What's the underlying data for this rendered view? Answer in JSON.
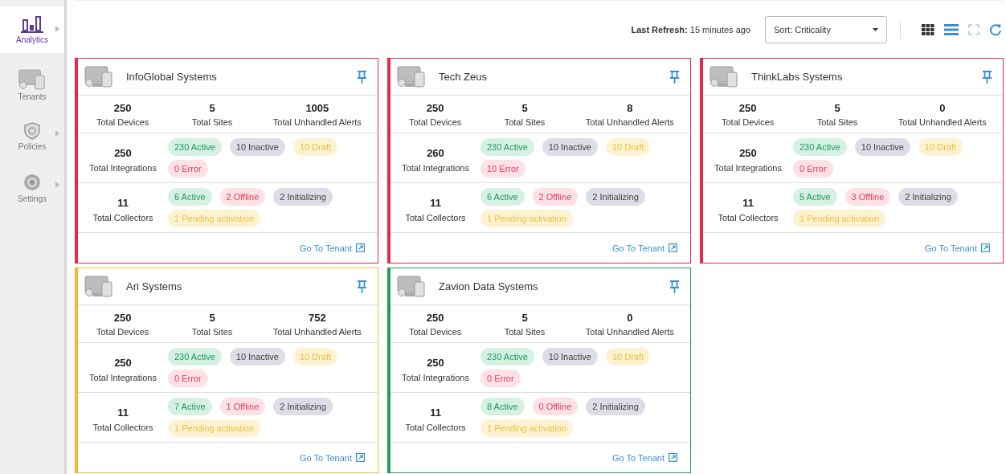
{
  "sidebar": {
    "items": [
      {
        "label": "Analytics",
        "selected": true,
        "expandable": true
      },
      {
        "label": "Tenants",
        "selected": false,
        "expandable": false
      },
      {
        "label": "Policies",
        "selected": false,
        "expandable": true
      },
      {
        "label": "Settings",
        "selected": false,
        "expandable": true
      }
    ]
  },
  "toolbar": {
    "refresh_label": "Last Refresh:",
    "refresh_value": "15 minutes ago",
    "sort": {
      "value": "Sort: Criticality"
    }
  },
  "cards": [
    {
      "name": "InfoGlobal Systems",
      "color": "#e8284a",
      "stats": [
        {
          "value": "250",
          "label": "Total Devices"
        },
        {
          "value": "5",
          "label": "Total Sites"
        },
        {
          "value": "1005",
          "label": "Total Unhandled Alerts"
        }
      ],
      "integrations": {
        "value": "250",
        "label": "Total Integrations",
        "badges": [
          {
            "kind": "good",
            "text": "230 Active"
          },
          {
            "kind": "neutral",
            "text": "10 Inactive"
          },
          {
            "kind": "warn",
            "text": "10 Draft"
          },
          {
            "kind": "bad",
            "text": "0 Error"
          }
        ]
      },
      "collectors": {
        "value": "11",
        "label": "Total Collectors",
        "badges": [
          {
            "kind": "good",
            "text": "6 Active"
          },
          {
            "kind": "bad",
            "text": "2 Offline"
          },
          {
            "kind": "neutral",
            "text": "2 Initializing"
          },
          {
            "kind": "warn",
            "text": "1 Pending activation"
          }
        ]
      },
      "link": "Go To Tenant"
    },
    {
      "name": "Tech Zeus",
      "color": "#e8284a",
      "stats": [
        {
          "value": "250",
          "label": "Total Devices"
        },
        {
          "value": "5",
          "label": "Total Sites"
        },
        {
          "value": "8",
          "label": "Total Unhandled Alerts"
        }
      ],
      "integrations": {
        "value": "260",
        "label": "Total Integrations",
        "badges": [
          {
            "kind": "good",
            "text": "230 Active"
          },
          {
            "kind": "neutral",
            "text": "10 Inactive"
          },
          {
            "kind": "warn",
            "text": "10 Draft"
          },
          {
            "kind": "bad",
            "text": "10 Error"
          }
        ]
      },
      "collectors": {
        "value": "11",
        "label": "Total Collectors",
        "badges": [
          {
            "kind": "good",
            "text": "6 Active"
          },
          {
            "kind": "bad",
            "text": "2 Offline"
          },
          {
            "kind": "neutral",
            "text": "2 Initializing"
          },
          {
            "kind": "warn",
            "text": "1 Pending activation"
          }
        ]
      },
      "link": "Go To Tenant"
    },
    {
      "name": "ThinkLabs Systems",
      "color": "#e8284a",
      "stats": [
        {
          "value": "250",
          "label": "Total Devices"
        },
        {
          "value": "5",
          "label": "Total Sites"
        },
        {
          "value": "0",
          "label": "Total Unhandled Alerts"
        }
      ],
      "integrations": {
        "value": "250",
        "label": "Total Integrations",
        "badges": [
          {
            "kind": "good",
            "text": "230 Active"
          },
          {
            "kind": "neutral",
            "text": "10 Inactive"
          },
          {
            "kind": "warn",
            "text": "10 Draft"
          },
          {
            "kind": "bad",
            "text": "0 Error"
          }
        ]
      },
      "collectors": {
        "value": "11",
        "label": "Total Collectors",
        "badges": [
          {
            "kind": "good",
            "text": "5 Active"
          },
          {
            "kind": "bad",
            "text": "3 Offline"
          },
          {
            "kind": "neutral",
            "text": "2 Initializing"
          },
          {
            "kind": "warn",
            "text": "1 Pending activation"
          }
        ]
      },
      "link": "Go To Tenant"
    },
    {
      "name": "Ari Systems",
      "color": "#f5b731",
      "stats": [
        {
          "value": "250",
          "label": "Total Devices"
        },
        {
          "value": "5",
          "label": "Total Sites"
        },
        {
          "value": "752",
          "label": "Total Unhandled Alerts"
        }
      ],
      "integrations": {
        "value": "250",
        "label": "Total Integrations",
        "badges": [
          {
            "kind": "good",
            "text": "230 Active"
          },
          {
            "kind": "neutral",
            "text": "10 Inactive"
          },
          {
            "kind": "warn",
            "text": "10 Draft"
          },
          {
            "kind": "bad",
            "text": "0 Error"
          }
        ]
      },
      "collectors": {
        "value": "11",
        "label": "Total Collectors",
        "badges": [
          {
            "kind": "good",
            "text": "7 Active"
          },
          {
            "kind": "bad",
            "text": "1 Offline"
          },
          {
            "kind": "neutral",
            "text": "2 Initializing"
          },
          {
            "kind": "warn",
            "text": "1 Pending activation"
          }
        ]
      },
      "link": "Go To Tenant"
    },
    {
      "name": "Zavion Data Systems",
      "color": "#1e9e5a",
      "stats": [
        {
          "value": "250",
          "label": "Total Devices"
        },
        {
          "value": "5",
          "label": "Total Sites"
        },
        {
          "value": "0",
          "label": "Total Unhandled Alerts"
        }
      ],
      "integrations": {
        "value": "250",
        "label": "Total Integrations",
        "badges": [
          {
            "kind": "good",
            "text": "230 Active"
          },
          {
            "kind": "neutral",
            "text": "10 Inactive"
          },
          {
            "kind": "warn",
            "text": "10 Draft"
          },
          {
            "kind": "bad",
            "text": "0 Error"
          }
        ]
      },
      "collectors": {
        "value": "11",
        "label": "Total Collectors",
        "badges": [
          {
            "kind": "good",
            "text": "8 Active"
          },
          {
            "kind": "bad",
            "text": "0 Offline"
          },
          {
            "kind": "neutral",
            "text": "2 Initializing"
          },
          {
            "kind": "warn",
            "text": "1 Pending activation"
          }
        ]
      },
      "link": "Go To Tenant"
    }
  ]
}
